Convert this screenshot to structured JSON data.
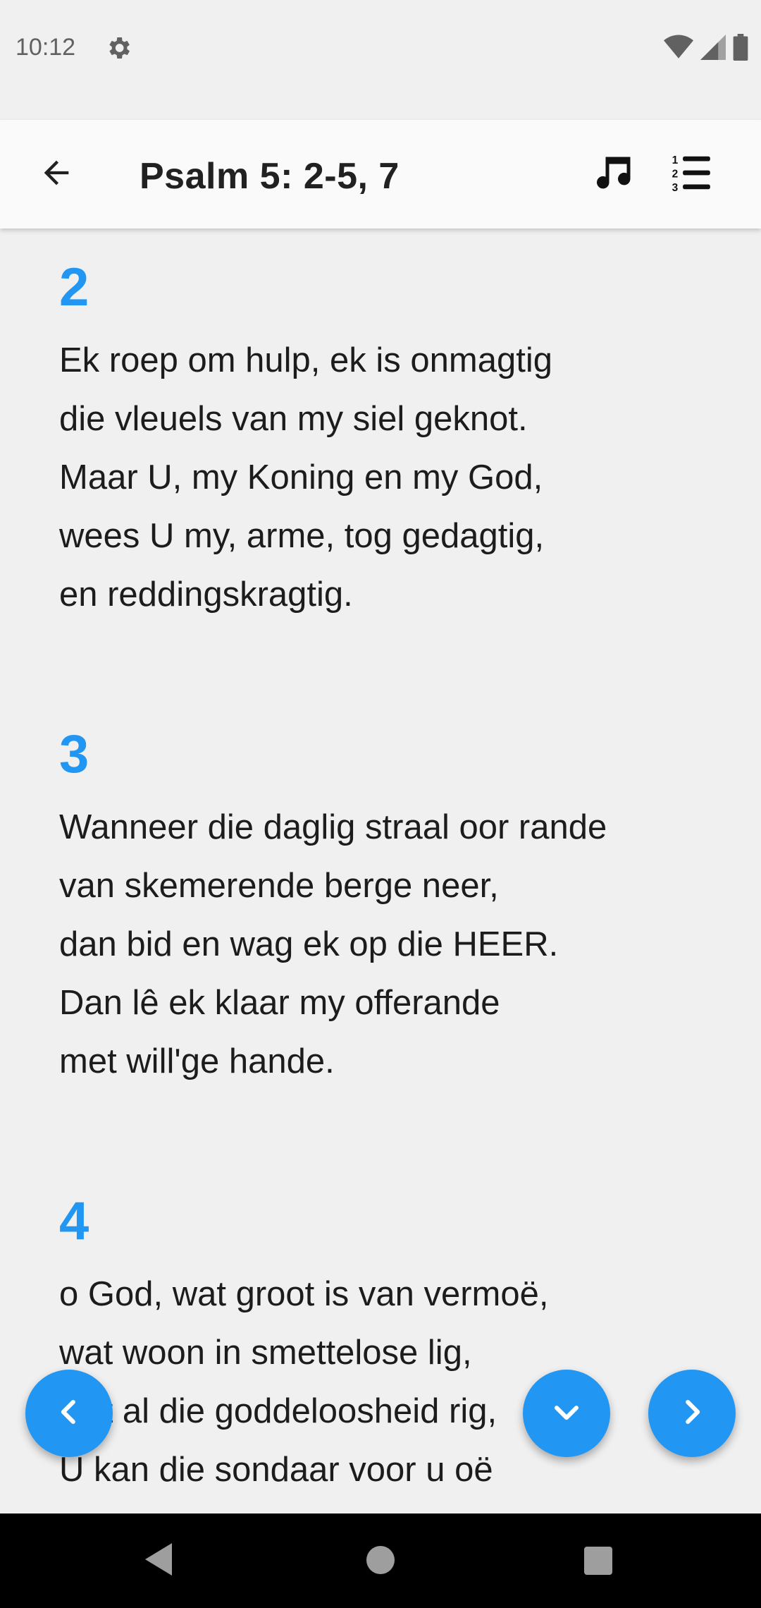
{
  "status_bar": {
    "time": "10:12",
    "icons": [
      "gear-icon",
      "wifi-icon",
      "signal-icon",
      "battery-icon"
    ]
  },
  "app_bar": {
    "title": "Psalm 5: 2-5, 7",
    "icons": [
      "back-arrow-icon",
      "music-note-icon",
      "numbered-list-icon"
    ]
  },
  "verses": [
    {
      "number": "2",
      "text": "Ek roep om hulp, ek is onmagtig\ndie vleuels van my siel geknot.\nMaar U, my Koning en my God,\nwees U my, arme, tog gedagtig,\nen reddingskragtig."
    },
    {
      "number": "3",
      "text": "Wanneer die daglig straal oor rande\nvan skemerende berge neer,\ndan bid en wag ek op die HEER.\nDan lê ek klaar my offerande\nmet will'ge hande."
    },
    {
      "number": "4",
      "text": "o God, wat groot is van vermoë,\nwat woon in smettelose lig,\nwat al die goddeloosheid rig,\nU kan die sondaar voor u oë"
    }
  ],
  "fabs": [
    "chevron-left-icon",
    "chevron-down-icon",
    "chevron-right-icon"
  ],
  "colors": {
    "accent": "#2196f3",
    "background": "#f0f0f0",
    "app_bar": "#fafafa",
    "text": "#1c1c1c"
  }
}
